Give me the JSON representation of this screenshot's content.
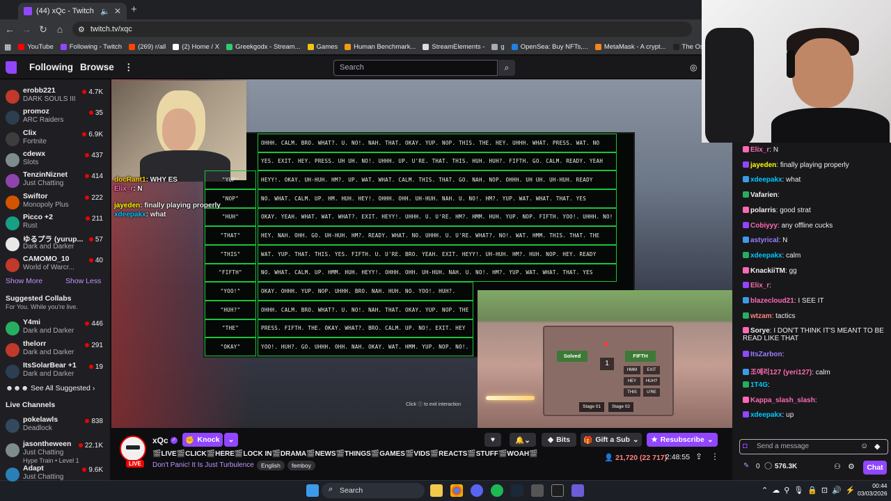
{
  "browser": {
    "tab_title": "(44) xQc - Twitch",
    "url": "twitch.tv/xqc",
    "bookmarks": [
      {
        "label": "YouTube",
        "color": "#ff0000"
      },
      {
        "label": "Following - Twitch",
        "color": "#9146ff"
      },
      {
        "label": "(269) r/all",
        "color": "#ff4500"
      },
      {
        "label": "(2) Home / X",
        "color": "#ffffff"
      },
      {
        "label": "Greekgodx - Stream...",
        "color": "#2ecc71"
      },
      {
        "label": "Games",
        "color": "#f1c40f"
      },
      {
        "label": "Human Benchmark...",
        "color": "#f39c12"
      },
      {
        "label": "StreamElements -",
        "color": "#dddddd"
      },
      {
        "label": "g",
        "color": "#aaaaaa"
      },
      {
        "label": "OpenSea: Buy NFTs,...",
        "color": "#2081e2"
      },
      {
        "label": "MetaMask - A crypt...",
        "color": "#f6851b"
      },
      {
        "label": "The Osbournes - Se...",
        "color": "#222222"
      }
    ]
  },
  "nav": {
    "following": "Following",
    "browse": "Browse",
    "more": "⋮",
    "search_placeholder": "Search"
  },
  "sidebar": {
    "followed": [
      {
        "name": "erobb221",
        "game": "DARK SOULS III",
        "viewers": "4.7K",
        "color": "#c0392b"
      },
      {
        "name": "promoz",
        "game": "ARC Raiders",
        "viewers": "35",
        "color": "#2c3e50"
      },
      {
        "name": "Clix",
        "game": "Fortnite",
        "viewers": "6.9K",
        "color": "#3d3d3d"
      },
      {
        "name": "cdewx",
        "game": "Slots",
        "viewers": "437",
        "color": "#7f8c8d"
      },
      {
        "name": "TenzinNiznet",
        "game": "Just Chatting",
        "viewers": "414",
        "color": "#8e44ad"
      },
      {
        "name": "Swiftor",
        "game": "Monopoly Plus",
        "viewers": "222",
        "color": "#d35400"
      },
      {
        "name": "Picco +2",
        "game": "Rust",
        "viewers": "211",
        "color": "#16a085"
      },
      {
        "name": "ゆるプラ (yurup...",
        "game": "Dark and Darker",
        "viewers": "57",
        "color": "#e8e8e8"
      },
      {
        "name": "CAMOMO_10",
        "game": "World of Warcr...",
        "viewers": "40",
        "color": "#c0392b"
      }
    ],
    "show_more": "Show More",
    "show_less": "Show Less",
    "suggested_title": "Suggested Collabs",
    "suggested_sub": "For You. While you're live.",
    "suggested": [
      {
        "name": "Y4mi",
        "game": "Dark and Darker",
        "viewers": "446",
        "color": "#27ae60"
      },
      {
        "name": "thelorr",
        "game": "Dark and Darker",
        "viewers": "291",
        "color": "#c0392b"
      },
      {
        "name": "ItsSolarBear +1",
        "game": "Dark and Darker",
        "viewers": "19",
        "color": "#2c3e50"
      }
    ],
    "see_all": "See All Suggested",
    "live_title": "Live Channels",
    "live": [
      {
        "name": "pokelawls",
        "game": "Deadlock",
        "viewers": "838",
        "color": "#34495e"
      },
      {
        "name": "jasontheween",
        "game": "Just Chatting",
        "viewers": "22.1K",
        "color": "#7f8c8d",
        "extra": "Hype Train • Level 1"
      },
      {
        "name": "Adapt",
        "game": "Just Chatting",
        "viewers": "9.6K",
        "color": "#2980b9"
      }
    ]
  },
  "video": {
    "overlay_chat": [
      {
        "user": "docRant1",
        "text": "WHY ES"
      },
      {
        "user": "Elix_r",
        "text": "N"
      },
      {
        "user": "jayeden",
        "text": "finally playing properly"
      },
      {
        "user": "xdeepakx",
        "text": "what"
      }
    ],
    "board": {
      "labels": [
        "\"YUP\"",
        "\"NOP\"",
        "\"HUH\"",
        "\"THAT\"",
        "\"THIS\"",
        "\"FIFTH\"",
        "\"YOO!\"",
        "\"HUH?\"",
        "\"THE\"",
        "\"OKAY\""
      ],
      "rows": [
        "OHHH. CALM. BRO. WHAT?. U. NO!. NAH. THAT. OKAY. YUP. NOP. THIS. THE. HEY. UHHH. WHAT. PRESS. WAT. NO",
        "YES. EXIT. HEY. PRESS. UH UH. NO!. UHHH. UP. U'RE. THAT. THIS. HUH. HUH?. FIFTH. GO. CALM. READY. YEAH",
        "HEYY!. OKAY. UH-HUH. HM?. UP. WAT. WHAT. CALM. THIS. THAT. GO. NAH. NOP. OHHH. UH UH. UH-HUH. READY",
        "NO. WHAT. CALM. UP. HM. HUH. HEY!. OHHH. OHH. UH-HUH. NAH. U. NO!. HM?. YUP. WAT. WHAT. THAT. YES",
        "OKAY. YEAH. WHAT. WAT. WHAT?. EXIT. HEYY!. UHHH. U. U'RE. HM?. HMM. HUH. YUP. NOP. FIFTH. YOO!. UHHH. NO!",
        "HEY. NAH. OHH. GO. UH-HUH. HM?. READY. WHAT. NO. UHHH. U. U'RE. WHAT?. NO!. WAT. HMM. THIS. THAT. THE",
        "WAT. YUP. THAT. THIS. YES. FIFTH. U. U'RE. BRO. YEAH. EXIT. HEYY!. UH-HUH. HM?. HUH. NOP. HEY. READY",
        "NO. WHAT. CALM. UP. HMM. HUH. HEYY!. OHHH. OHH. UH-HUH. NAH. U. NO!. HM?. YUP. WAT. WHAT. THAT. YES",
        "OKAY. OHHH. YUP. NOP. UHHH. BRO. NAH. HUH. NO. YOO!. HUH?.",
        "OHHH. CALM. BRO. WHAT?. U. NO!. NAH. THAT. OKAY. YUP. NOP. THE",
        "PRESS. FIFTH. THE. OKAY. WHAT?. BRO. CALM. UP. NO!. EXIT. HEY",
        "YOO!. HUH?. GO. UHHH. OHH. NAH. OKAY. WAT. HMM. YUP. NOP. NO!."
      ]
    },
    "pip": {
      "solved": "Solved",
      "fifth": "FIFTH",
      "number": "1",
      "mini_labels": [
        "HMM",
        "EXIT",
        "HEY",
        "HUH?",
        "THIS",
        "U'RE"
      ],
      "stage1": "Stage 01",
      "stage2": "Stage 02"
    },
    "exit_hint": "Click ⓘ to exit interaction"
  },
  "stream": {
    "streamer": "xQc",
    "knock": "Knock",
    "bits": "Bits",
    "gift": "Gift a Sub",
    "resub": "Resubscribe",
    "title": "🎬LIVE🎬CLICK🎬HERE🎬LOCK IN🎬DRAMA🎬NEWS🎬THINGS🎬GAMES🎬VIDS🎬REACTS🎬STUFF🎬WOAH🎬",
    "category": "Don't Panic! It Is Just Turbulence",
    "tags": [
      "English",
      "femboy"
    ],
    "viewers": "21,720 (22 717)",
    "uptime": "2:48:55",
    "live": "LIVE"
  },
  "chat": {
    "messages": [
      {
        "user": "Elix_r",
        "text": "N",
        "color": "#ff69b4"
      },
      {
        "user": "jayeden",
        "text": "finally playing properly",
        "color": "#ffff00"
      },
      {
        "user": "xdeepakx",
        "text": "what",
        "color": "#00c8ff"
      },
      {
        "user": "Vafarien",
        "text": "",
        "color": "#efeff1"
      },
      {
        "user": "polarris",
        "text": "good strat",
        "color": "#efeff1"
      },
      {
        "user": "Cobiyyy",
        "text": "any offline cucks",
        "color": "#ff69b4"
      },
      {
        "user": "astyrical",
        "text": "N",
        "color": "#9b7cff"
      },
      {
        "user": "xdeepakx",
        "text": "calm",
        "color": "#00c8ff"
      },
      {
        "user": "KnackiiTM",
        "text": "gg",
        "color": "#efeff1"
      },
      {
        "user": "Elix_r",
        "text": "",
        "color": "#ff69b4"
      },
      {
        "user": "blazecloud21",
        "text": "I SEE IT",
        "color": "#ff69b4"
      },
      {
        "user": "wtzam",
        "text": "tactics",
        "color": "#ff8280"
      },
      {
        "user": "Sorye",
        "text": "I DON'T THINK IT'S MEANT TO BE READ LIKE THAT",
        "color": "#efeff1"
      },
      {
        "user": "ItsZarbon",
        "text": "",
        "color": "#9b7cff"
      },
      {
        "user": "조예리127 (yeri127)",
        "text": "calm",
        "color": "#ff69b4"
      },
      {
        "user": "1T4G",
        "text": "",
        "color": "#00c8ff"
      },
      {
        "user": "Kappa_slash_slash",
        "text": "",
        "color": "#ff69b4"
      },
      {
        "user": "xdeepakx",
        "text": "up",
        "color": "#00c8ff"
      }
    ],
    "placeholder": "Send a message",
    "points": "0",
    "channel_points": "576.3K",
    "send": "Chat"
  },
  "taskbar": {
    "search": "Search",
    "time": "00:44",
    "date": "03/03/2026"
  }
}
